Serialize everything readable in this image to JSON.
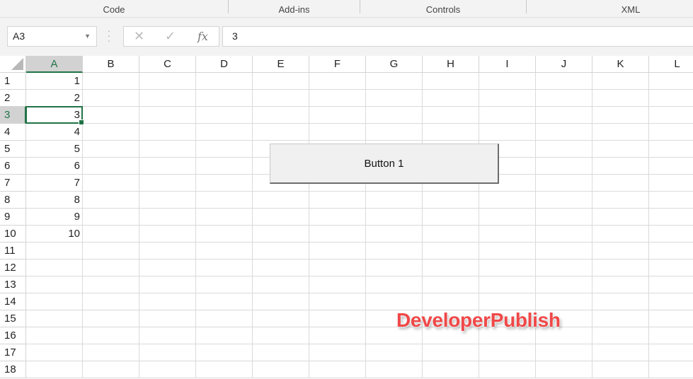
{
  "ribbon": {
    "groups": [
      "Code",
      "Add-ins",
      "Controls",
      "XML"
    ]
  },
  "formula_bar": {
    "name_box": "A3",
    "cancel_icon": "✕",
    "enter_icon": "✓",
    "fx_label": "fx",
    "value": "3"
  },
  "sheet": {
    "columns": [
      "A",
      "B",
      "C",
      "D",
      "E",
      "F",
      "G",
      "H",
      "I",
      "J",
      "K",
      "L"
    ],
    "rows": [
      "1",
      "2",
      "3",
      "4",
      "5",
      "6",
      "7",
      "8",
      "9",
      "10",
      "11",
      "12",
      "13",
      "14",
      "15",
      "16",
      "17",
      "18"
    ],
    "column_a_values": [
      "1",
      "2",
      "3",
      "4",
      "5",
      "6",
      "7",
      "8",
      "9",
      "10"
    ],
    "selected_cell": "A3",
    "accent_color": "#217346"
  },
  "form_button": {
    "label": "Button 1"
  },
  "watermark": "DeveloperPublish"
}
